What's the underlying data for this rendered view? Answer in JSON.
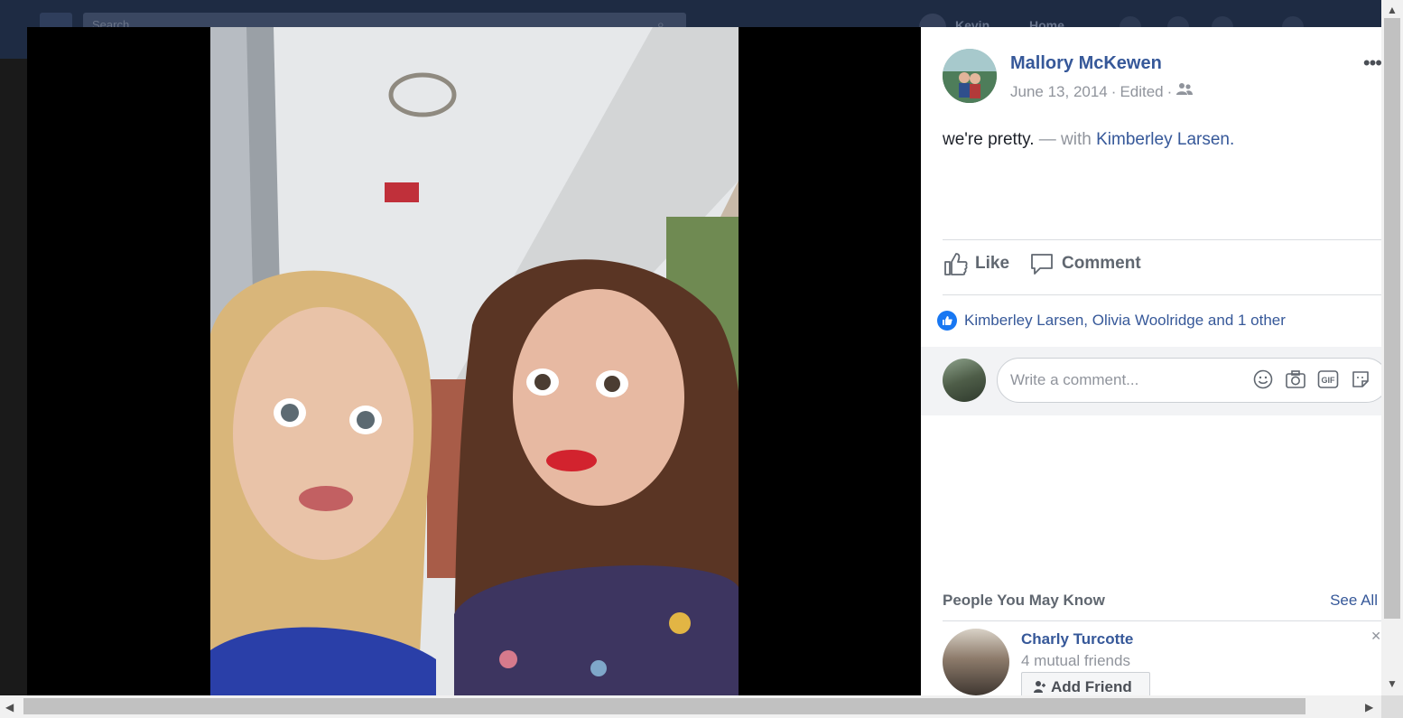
{
  "topbar": {
    "search_placeholder": "Search",
    "profile_name": "Kevin",
    "home_label": "Home"
  },
  "post": {
    "author": "Mallory McKewen",
    "date": "June 13, 2014",
    "separator": "·",
    "edited": "Edited",
    "caption_text": "we're pretty.",
    "caption_with": "— with",
    "tagged_person": "Kimberley Larsen",
    "tagged_suffix": ".",
    "more_label": "•••"
  },
  "actions": {
    "like_label": "Like",
    "comment_label": "Comment"
  },
  "reactions": {
    "text": "Kimberley Larsen, Olivia Woolridge and 1 other"
  },
  "comment_box": {
    "placeholder": "Write a comment...",
    "icons": [
      "emoji-icon",
      "camera-icon",
      "gif-icon",
      "sticker-icon"
    ],
    "gif_label": "GIF"
  },
  "people_you_may_know": {
    "title": "People You May Know",
    "see_all": "See All",
    "suggestion": {
      "name": "Charly Turcotte",
      "mutual": "4 mutual friends",
      "add_label": "Add Friend"
    }
  },
  "colors": {
    "link": "#365899",
    "like_blue": "#1877f2",
    "meta_gray": "#90949c"
  }
}
